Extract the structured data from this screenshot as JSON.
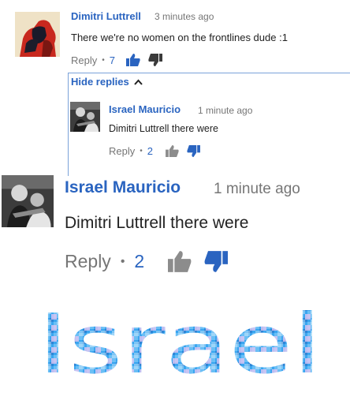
{
  "comment": {
    "author": "Dimitri Luttrell",
    "time": "3 minutes ago",
    "text": "There we're no women on the frontlines dude :1",
    "reply_label": "Reply",
    "separator": "•",
    "likes": "7"
  },
  "hide_replies_label": "Hide replies",
  "reply": {
    "author": "Israel Mauricio",
    "time": "1 minute ago",
    "text": "Dimitri Luttrell there were",
    "reply_label": "Reply",
    "separator": "•",
    "likes": "2"
  },
  "zoomed_reply": {
    "author": "Israel Mauricio",
    "time": "1 minute ago",
    "text": "Dimitri Luttrell there were",
    "reply_label": "Reply",
    "separator": "•",
    "likes": "2"
  },
  "pixel_word": "Israel",
  "colors": {
    "link_blue": "#2a64c0",
    "thumb_up_active": "#2a64c0",
    "thumb_grey": "#767676"
  }
}
